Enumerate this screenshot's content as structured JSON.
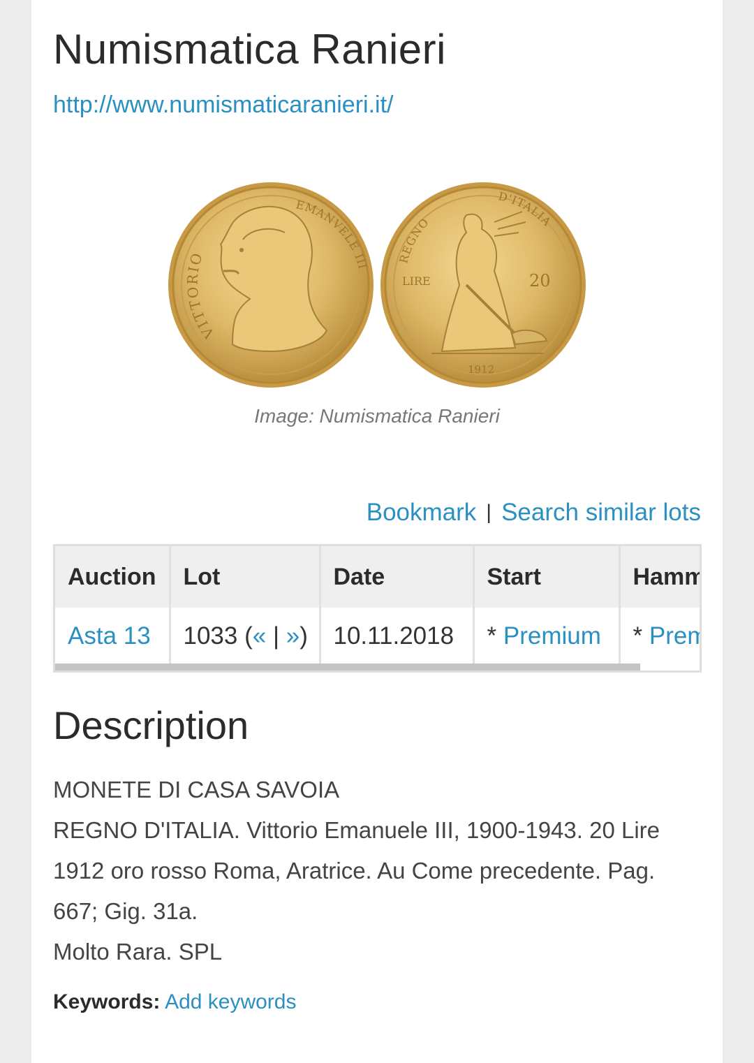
{
  "site": {
    "title": "Numismatica Ranieri",
    "url": "http://www.numismaticaranieri.it/"
  },
  "image": {
    "caption": "Image: Numismatica Ranieri",
    "obverse_legend_left": "VITTORIO",
    "obverse_legend_right": "EMANVELE III",
    "reverse_legend_left": "REGNO",
    "reverse_legend_right": "D'ITALIA",
    "reverse_denomination_label": "LIRE",
    "reverse_value": "20",
    "reverse_year": "1912",
    "gold_color": "#d9b25a"
  },
  "actions": {
    "bookmark": "Bookmark",
    "separator": "|",
    "search_similar": "Search similar lots"
  },
  "table": {
    "headers": [
      "Auction",
      "Lot",
      "Date",
      "Start",
      "Hammer"
    ],
    "row": {
      "auction": "Asta 13",
      "lot_number": "1033",
      "lot_prev": "«",
      "lot_sep": "|",
      "lot_next": "»",
      "date": "10.11.2018",
      "start_prefix": "* ",
      "start_link": "Premium",
      "hammer_prefix": "* ",
      "hammer_link": "Premium"
    }
  },
  "description": {
    "heading": "Description",
    "lines": [
      "MONETE DI CASA SAVOIA",
      "REGNO D'ITALIA. Vittorio Emanuele III, 1900-1943. 20 Lire",
      "1912 oro rosso Roma, Aratrice. Au Come precedente. Pag.",
      "667; Gig. 31a.",
      "Molto Rara. SPL"
    ]
  },
  "keywords": {
    "label": "Keywords:",
    "link": "Add keywords"
  }
}
